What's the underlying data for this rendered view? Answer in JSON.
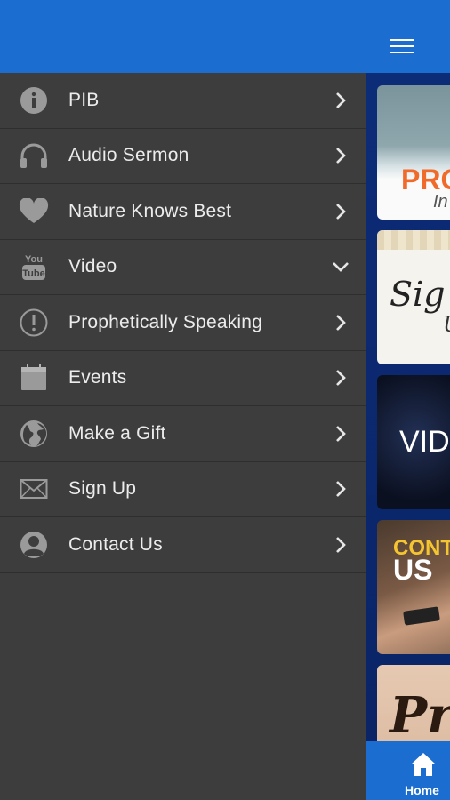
{
  "drawer": {
    "items": [
      {
        "label": "PIB",
        "icon": "info-icon",
        "indicator": "chevron-right"
      },
      {
        "label": "Audio Sermon",
        "icon": "headphones-icon",
        "indicator": "chevron-right"
      },
      {
        "label": "Nature Knows Best",
        "icon": "heart-icon",
        "indicator": "chevron-right"
      },
      {
        "label": "Video",
        "icon": "youtube-icon",
        "indicator": "chevron-down"
      },
      {
        "label": "Prophetically Speaking",
        "icon": "alert-icon",
        "indicator": "chevron-right"
      },
      {
        "label": "Events",
        "icon": "calendar-icon",
        "indicator": "chevron-right"
      },
      {
        "label": "Make a Gift",
        "icon": "globe-icon",
        "indicator": "chevron-right"
      },
      {
        "label": "Sign Up",
        "icon": "envelope-icon",
        "indicator": "chevron-right"
      },
      {
        "label": "Contact Us",
        "icon": "user-icon",
        "indicator": "chevron-right"
      }
    ],
    "youtube_icon_text": {
      "top": "You",
      "bottom": "Tube"
    }
  },
  "content": {
    "tiles": [
      {
        "lines": [
          "PRO",
          "In"
        ]
      },
      {
        "lines": [
          "Sig",
          "U"
        ]
      },
      {
        "lines": [
          "VID"
        ]
      },
      {
        "lines": [
          "CONT",
          "US"
        ]
      },
      {
        "lines": [
          "Pr"
        ]
      }
    ]
  },
  "tabbar": {
    "home_label": "Home"
  },
  "colors": {
    "header_blue": "#1c6dd0",
    "drawer_bg": "#3d3d3d",
    "menu_text": "#ececec",
    "icon_gray": "#9a9a9a"
  }
}
